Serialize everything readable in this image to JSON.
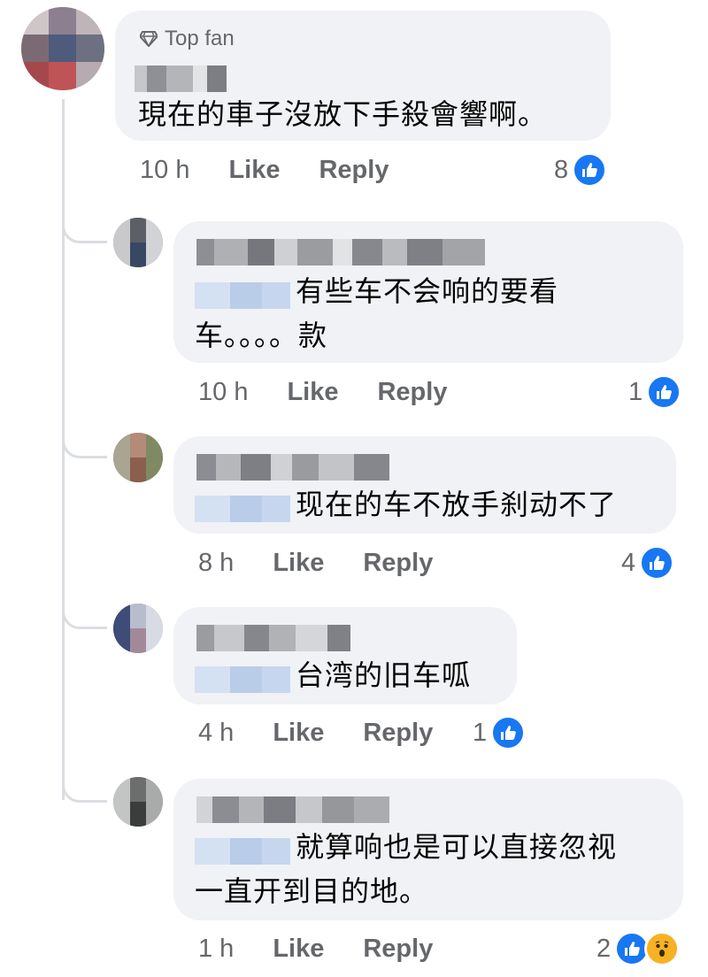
{
  "comments": [
    {
      "badge": "Top fan",
      "text": "現在的車子沒放下手殺會響啊。",
      "time": "10 h",
      "like_label": "Like",
      "reply_label": "Reply",
      "reaction_count": "8"
    },
    {
      "text_line1": "有些车不会响的要看",
      "text_line2": "车。。。。款",
      "time": "10 h",
      "like_label": "Like",
      "reply_label": "Reply",
      "reaction_count": "1"
    },
    {
      "text": "现在的车不放手刹动不了",
      "time": "8 h",
      "like_label": "Like",
      "reply_label": "Reply",
      "reaction_count": "4"
    },
    {
      "text": "台湾的旧车呱",
      "time": "4 h",
      "like_label": "Like",
      "reply_label": "Reply",
      "reaction_count": "1"
    },
    {
      "text_line1": "就算响也是可以直接忽视",
      "text_line2": "一直开到目的地。",
      "time": "1 h",
      "like_label": "Like",
      "reply_label": "Reply",
      "reaction_count": "2"
    }
  ],
  "colors": {
    "bubble": "#f0f2f5",
    "meta_text": "#65676b",
    "like_blue": "#1877f2",
    "wow_yellow": "#f7b125",
    "thread_line": "#dadde1"
  },
  "icons": {
    "badge": "diamond-icon",
    "reaction_primary": "thumbs-up-icon",
    "reaction_secondary": "wow-face-icon"
  }
}
